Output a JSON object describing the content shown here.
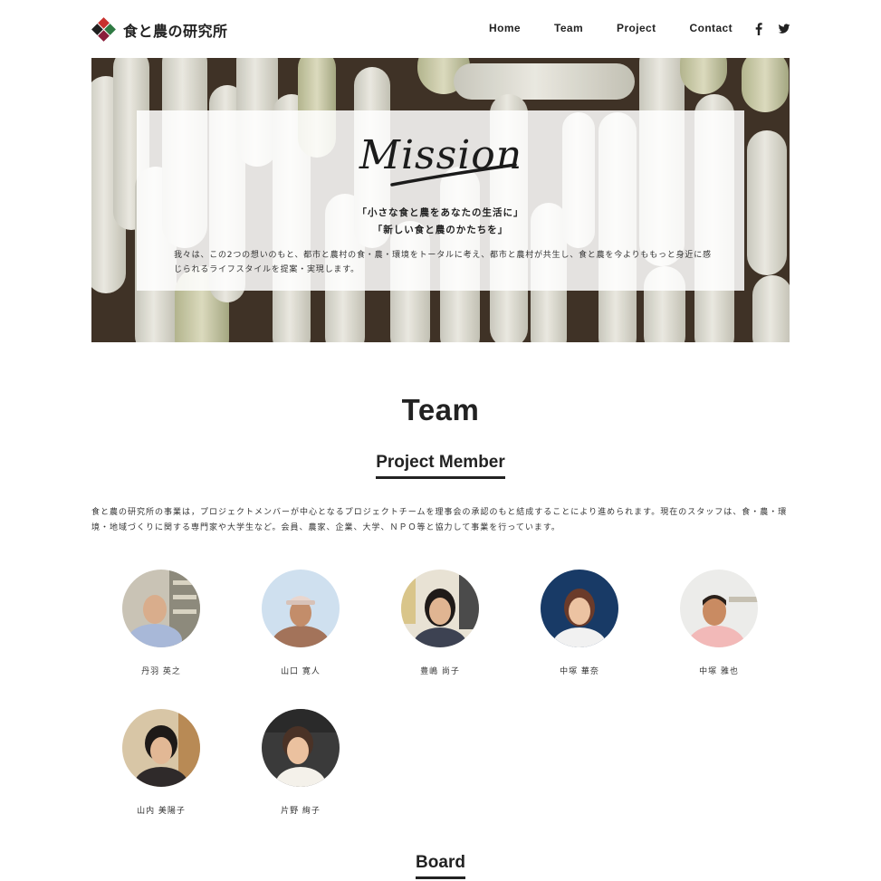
{
  "site": {
    "logo_text": "食と農の研究所"
  },
  "nav": {
    "items": [
      "Home",
      "Team",
      "Project",
      "Contact"
    ],
    "social_icons": [
      "facebook-icon",
      "twitter-icon"
    ]
  },
  "mission": {
    "heading": "Mission",
    "lines": [
      "「小さな食と農をあなたの生活に」",
      "「新しい食と農のかたちを」"
    ],
    "body": "我々は、この2つの想いのもと、都市と農村の食・農・環境をトータルに考え、都市と農村が共生し、食と農を今よりももっと身近に感じられるライフスタイルを提案・実現します。"
  },
  "team": {
    "title": "Team",
    "project_member_heading": "Project Member",
    "intro": "食と農の研究所の事業は，プロジェクトメンバーが中心となるプロジェクトチームを理事会の承認のもと結成することにより進められます。現在のスタッフは、食・農・環境・地域づくりに関する専門家や大学生など。会員、農家、企業、大学、ＮＰＯ等と協力して事業を行っています。",
    "members": [
      {
        "name": "丹羽 英之"
      },
      {
        "name": "山口 寛人"
      },
      {
        "name": "豊嶋 尚子"
      },
      {
        "name": "中塚 華奈"
      },
      {
        "name": "中塚 雅也"
      },
      {
        "name": "山内 美陽子"
      },
      {
        "name": "片野 絢子"
      }
    ],
    "board_heading": "Board"
  },
  "colors": {
    "accent_red": "#c8312e",
    "accent_green": "#2f7a43",
    "accent_black": "#222222",
    "text": "#222222"
  }
}
